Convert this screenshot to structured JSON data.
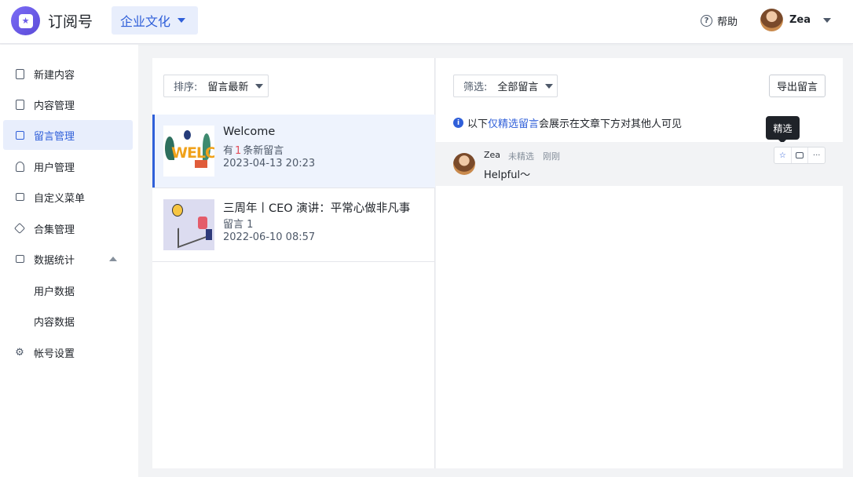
{
  "header": {
    "app_title": "订阅号",
    "account_name": "企业文化",
    "help_label": "帮助",
    "help_icon_glyph": "?",
    "user_name": "Zea"
  },
  "sidebar": {
    "items": [
      {
        "label": "新建内容",
        "icon": "new-content-icon"
      },
      {
        "label": "内容管理",
        "icon": "document-icon"
      },
      {
        "label": "留言管理",
        "icon": "comment-icon",
        "active": true
      },
      {
        "label": "用户管理",
        "icon": "users-icon"
      },
      {
        "label": "自定义菜单",
        "icon": "menu-icon"
      },
      {
        "label": "合集管理",
        "icon": "layers-icon"
      },
      {
        "label": "数据统计",
        "icon": "chart-icon",
        "expanded": true
      },
      {
        "label": "用户数据",
        "sub": true
      },
      {
        "label": "内容数据",
        "sub": true
      },
      {
        "label": "帐号设置",
        "icon": "gear-icon"
      }
    ]
  },
  "list": {
    "sort_label": "排序:",
    "sort_value": "留言最新",
    "articles": [
      {
        "title": "Welcome",
        "count_prefix": "有",
        "count": "1",
        "count_suffix": "条新留言",
        "date": "2023-04-13 20:23"
      },
      {
        "title": "三周年丨CEO 演讲：平常心做非凡事",
        "count_text": "留言 1",
        "date": "2022-06-10 08:57"
      }
    ]
  },
  "detail": {
    "filter_label": "筛选:",
    "filter_value": "全部留言",
    "export_label": "导出留言",
    "notice_prefix": "以下",
    "notice_link": "仅精选留言",
    "notice_suffix": "会展示在文章下方对其他人可见",
    "info_glyph": "i",
    "tooltip": "精选",
    "comment": {
      "name": "Zea",
      "status": "未精选",
      "time": "刚刚",
      "text": "Helpful～"
    },
    "actions": {
      "star_glyph": "☆",
      "more_glyph": "···"
    }
  },
  "colors": {
    "accent": "#2f5fd9",
    "active_bg": "#e8eefc",
    "highlight_count": "#e34d59"
  }
}
